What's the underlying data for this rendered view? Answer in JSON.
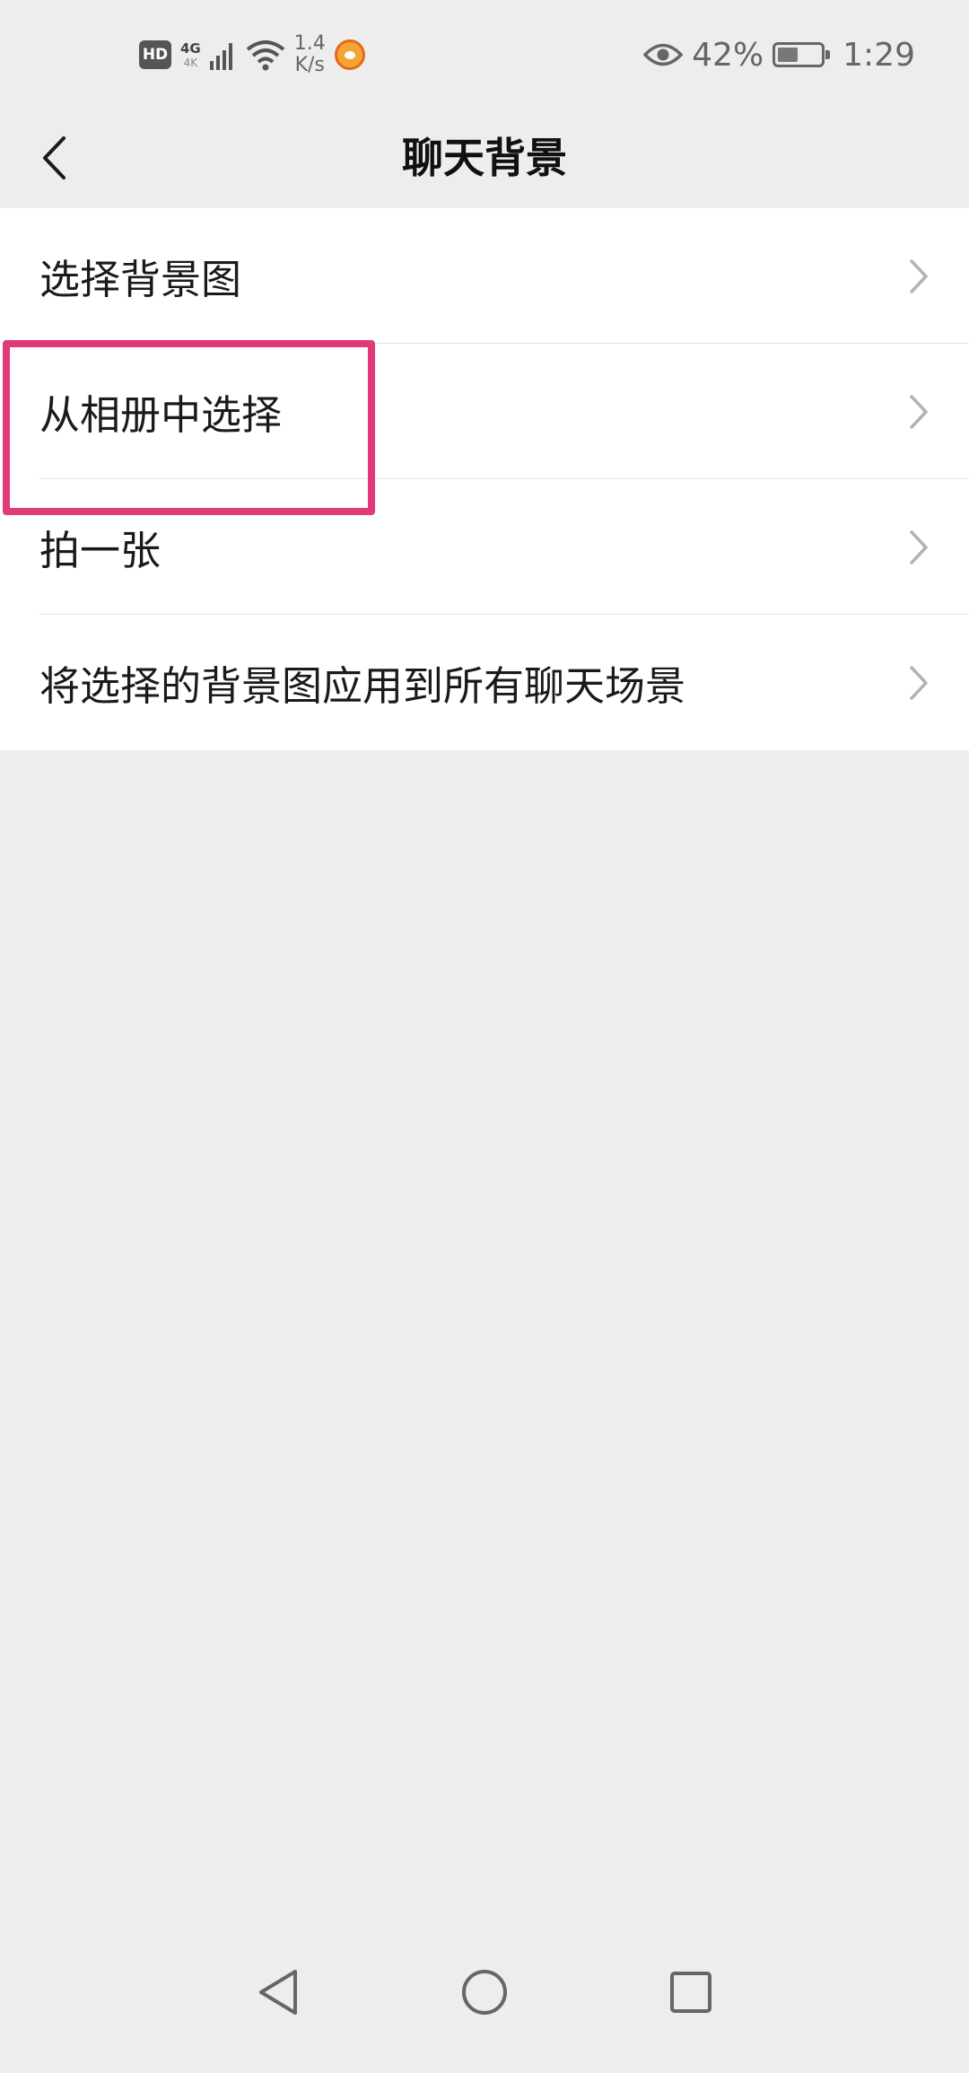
{
  "status_bar": {
    "hd": "HD",
    "network": "4G",
    "network_sub": "4K",
    "speed_value": "1.4",
    "speed_unit": "K/s",
    "battery": "42%",
    "time": "1:29"
  },
  "header": {
    "title": "聊天背景"
  },
  "menu": {
    "items": [
      {
        "label": "选择背景图"
      },
      {
        "label": "从相册中选择"
      },
      {
        "label": "拍一张"
      },
      {
        "label": "将选择的背景图应用到所有聊天场景"
      }
    ]
  },
  "colors": {
    "background": "#ededed",
    "list_background": "#ffffff",
    "highlight": "#e03a78",
    "chevron": "#b2b2b2"
  },
  "icons": {
    "back": "chevron-left-icon",
    "item_arrow": "chevron-right-icon",
    "nav_back": "triangle-back-icon",
    "nav_home": "circle-home-icon",
    "nav_recent": "square-recent-icon"
  }
}
